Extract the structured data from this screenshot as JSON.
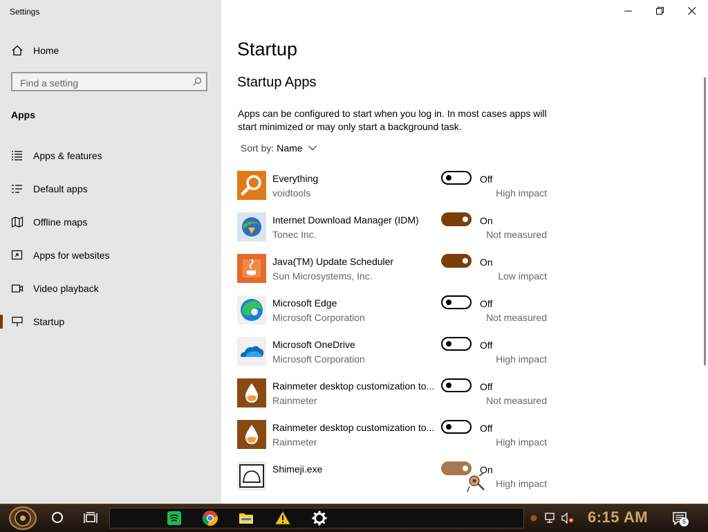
{
  "window": {
    "title": "Settings"
  },
  "sidebar": {
    "home_label": "Home",
    "search_placeholder": "Find a setting",
    "section_label": "Apps",
    "items": [
      {
        "label": "Apps & features",
        "icon": "list-icon"
      },
      {
        "label": "Default apps",
        "icon": "default-apps-icon"
      },
      {
        "label": "Offline maps",
        "icon": "map-icon"
      },
      {
        "label": "Apps for websites",
        "icon": "link-window-icon"
      },
      {
        "label": "Video playback",
        "icon": "video-icon"
      },
      {
        "label": "Startup",
        "icon": "startup-icon",
        "active": true
      }
    ]
  },
  "main": {
    "title": "Startup",
    "subtitle": "Startup Apps",
    "description": "Apps can be configured to start when you log in. In most cases apps will start minimized or may only start a background task.",
    "sort_label": "Sort by:",
    "sort_value": "Name",
    "apps": [
      {
        "name": "Everything",
        "publisher": "voidtools",
        "state": "Off",
        "enabled": false,
        "impact": "High impact",
        "icon": "everything-icon"
      },
      {
        "name": "Internet Download Manager (IDM)",
        "publisher": "Tonec Inc.",
        "state": "On",
        "enabled": true,
        "impact": "Not measured",
        "icon": "idm-icon"
      },
      {
        "name": "Java(TM) Update Scheduler",
        "publisher": "Sun Microsystems, Inc.",
        "state": "On",
        "enabled": true,
        "impact": "Low impact",
        "icon": "java-icon"
      },
      {
        "name": "Microsoft Edge",
        "publisher": "Microsoft Corporation",
        "state": "Off",
        "enabled": false,
        "impact": "Not measured",
        "icon": "edge-icon"
      },
      {
        "name": "Microsoft OneDrive",
        "publisher": "Microsoft Corporation",
        "state": "Off",
        "enabled": false,
        "impact": "High impact",
        "icon": "onedrive-icon"
      },
      {
        "name": "Rainmeter desktop customization to...",
        "publisher": "Rainmeter",
        "state": "Off",
        "enabled": false,
        "impact": "Not measured",
        "icon": "rainmeter-icon"
      },
      {
        "name": "Rainmeter desktop customization to...",
        "publisher": "Rainmeter",
        "state": "Off",
        "enabled": false,
        "impact": "High impact",
        "icon": "rainmeter-icon"
      },
      {
        "name": "Shimeji.exe",
        "publisher": "",
        "state": "On",
        "enabled": true,
        "impact": "High impact",
        "icon": "shimeji-icon"
      }
    ]
  },
  "taskbar": {
    "clock": "6:15 AM",
    "notification_count": "5",
    "pinned": [
      "spotify-icon",
      "chrome-icon",
      "file-explorer-icon",
      "warning-icon",
      "settings-gear-icon"
    ]
  },
  "colors": {
    "accent": "#7a3e0b",
    "sidebar_bg": "#e6e6e6",
    "clock": "#c9a86a"
  }
}
